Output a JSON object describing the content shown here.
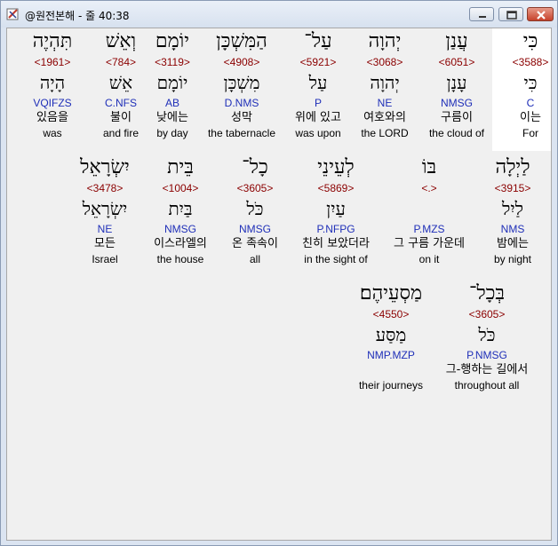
{
  "window": {
    "title": "@원전본해 - 줄 40:38",
    "app_icon": "bible-tools-icon",
    "controls": [
      "minimize-icon",
      "maximize-icon",
      "close-icon"
    ]
  },
  "words": [
    {
      "hebrew": "כִּי",
      "strongs": "<3588>",
      "lemma": "כִּי",
      "morph": "C",
      "korean": "이는",
      "english": "For",
      "selected": true
    },
    {
      "hebrew": "עֲנַן",
      "strongs": "<6051>",
      "lemma": "עָנָן",
      "morph": "NMSG",
      "korean": "구름이",
      "english": "the cloud of"
    },
    {
      "hebrew": "יְהוָה",
      "strongs": "<3068>",
      "lemma": "יְהוָה",
      "morph": "NE",
      "korean": "여호와의",
      "english": "the LORD"
    },
    {
      "hebrew": "עַל־",
      "strongs": "<5921>",
      "lemma": "עַל",
      "morph": "P",
      "korean": "위에 있고",
      "english": "was upon"
    },
    {
      "hebrew": "הַמִּשְׁכָּן",
      "strongs": "<4908>",
      "lemma": "מִשְׁכָּן",
      "morph": "D.NMS",
      "korean": "성막",
      "english": "the tabernacle"
    },
    {
      "hebrew": "יוֹמָם",
      "strongs": "<3119>",
      "lemma": "יוֹמָם",
      "morph": "AB",
      "korean": "낮에는",
      "english": "by day"
    },
    {
      "hebrew": "וְאֵשׁ",
      "strongs": "<784>",
      "lemma": "אֵשׁ",
      "morph": "C.NFS",
      "korean": "불이",
      "english": "and fire"
    },
    {
      "hebrew": "תִּהְיֶה",
      "strongs": "<1961>",
      "lemma": "הָיָה",
      "morph": "VQIFZS",
      "korean": "있음을",
      "english": "was"
    },
    {
      "hebrew": "לַיְלָה",
      "strongs": "<3915>",
      "lemma": "לַיִל",
      "morph": "NMS",
      "korean": "밤에는",
      "english": "by night"
    },
    {
      "hebrew": "בּוֹ",
      "strongs": "<.>",
      "lemma": "",
      "morph": "P.MZS",
      "korean": "그 구름 가운데",
      "english": "on it"
    },
    {
      "hebrew": "לְעֵינֵי",
      "strongs": "<5869>",
      "lemma": "עַיִן",
      "morph": "P.NFPG",
      "korean": "친히 보았더라",
      "english": "in the sight of"
    },
    {
      "hebrew": "כָל־",
      "strongs": "<3605>",
      "lemma": "כֹּל",
      "morph": "NMSG",
      "korean": "온 족속이",
      "english": "all"
    },
    {
      "hebrew": "בֵּית",
      "strongs": "<1004>",
      "lemma": "בַּיִת",
      "morph": "NMSG",
      "korean": "이스라엘의",
      "english": "the house"
    },
    {
      "hebrew": "יִשְׂרָאֵל",
      "strongs": "<3478>",
      "lemma": "יִשְׂרָאֵל",
      "morph": "NE",
      "korean": "모든",
      "english": "Israel"
    },
    {
      "hebrew": "בְּכָל־",
      "strongs": "<3605>",
      "lemma": "כֹּל",
      "morph": "P.NMSG",
      "korean": "그-행하는 길에서",
      "english": "throughout all"
    },
    {
      "hebrew": "מַסְעֵיהֶם׃",
      "strongs": "<4550>",
      "lemma": "מַסַּע",
      "morph": "NMP.MZP",
      "korean": "",
      "english": "their journeys"
    }
  ]
}
